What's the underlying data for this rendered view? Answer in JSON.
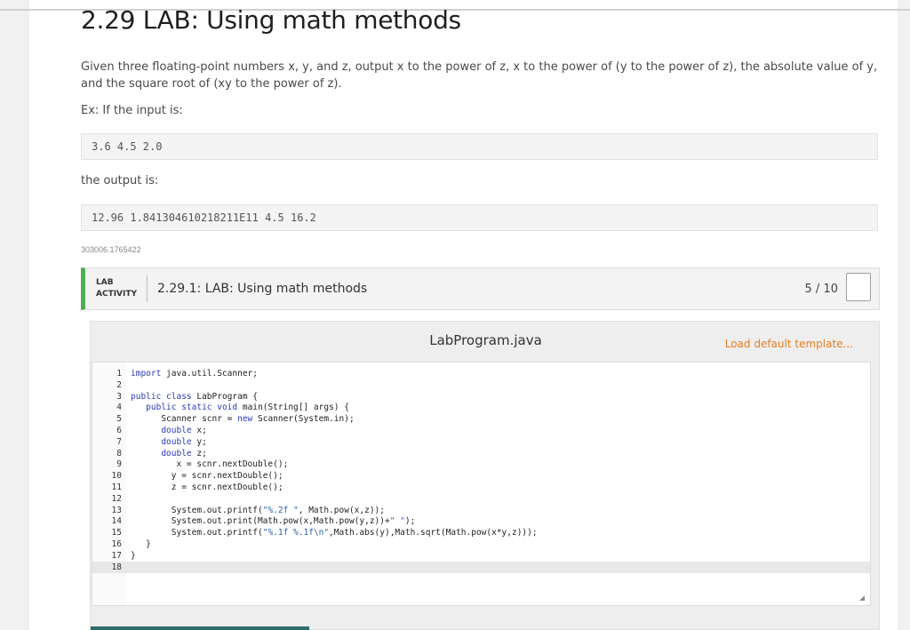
{
  "page": {
    "title": "2.29 LAB: Using math methods",
    "description": "Given three floating-point numbers x, y, and z, output x to the power of z, x to the power of (y to the power of z), the absolute value of y, and the square root of (xy to the power of z).",
    "example_label": "Ex: If the input is:",
    "input_example": "3.6 4.5 2.0",
    "output_label": "the output is:",
    "output_example": "12.96 1.841304610218211E11 4.5 16.2",
    "id_text": "303006.1765422"
  },
  "activity": {
    "tag_line1": "LAB",
    "tag_line2": "ACTIVITY",
    "title": "2.29.1: LAB: Using math methods",
    "score": "5 / 10",
    "accent_color": "#4caf50"
  },
  "editor": {
    "file_name": "LabProgram.java",
    "load_template": "Load default template...",
    "lines": [
      {
        "n": "1",
        "segments": [
          {
            "t": "import",
            "c": "kw"
          },
          {
            "t": " java.util.Scanner;",
            "c": ""
          }
        ]
      },
      {
        "n": "2",
        "segments": []
      },
      {
        "n": "3",
        "segments": [
          {
            "t": "public class",
            "c": "kw"
          },
          {
            "t": " LabProgram {",
            "c": ""
          }
        ]
      },
      {
        "n": "4",
        "segments": [
          {
            "t": "   ",
            "c": ""
          },
          {
            "t": "public static void",
            "c": "kw"
          },
          {
            "t": " main(String[] args) {",
            "c": ""
          }
        ]
      },
      {
        "n": "5",
        "segments": [
          {
            "t": "      Scanner scnr = ",
            "c": ""
          },
          {
            "t": "new",
            "c": "kw"
          },
          {
            "t": " Scanner(System.in);",
            "c": ""
          }
        ]
      },
      {
        "n": "6",
        "segments": [
          {
            "t": "      ",
            "c": ""
          },
          {
            "t": "double",
            "c": "kw"
          },
          {
            "t": " x;",
            "c": ""
          }
        ]
      },
      {
        "n": "7",
        "segments": [
          {
            "t": "      ",
            "c": ""
          },
          {
            "t": "double",
            "c": "kw"
          },
          {
            "t": " y;",
            "c": ""
          }
        ]
      },
      {
        "n": "8",
        "segments": [
          {
            "t": "      ",
            "c": ""
          },
          {
            "t": "double",
            "c": "kw"
          },
          {
            "t": " z;",
            "c": ""
          }
        ]
      },
      {
        "n": "9",
        "segments": [
          {
            "t": "         x = scnr.nextDouble();",
            "c": ""
          }
        ]
      },
      {
        "n": "10",
        "segments": [
          {
            "t": "        y = scnr.nextDouble();",
            "c": ""
          }
        ]
      },
      {
        "n": "11",
        "segments": [
          {
            "t": "        z = scnr.nextDouble();",
            "c": ""
          }
        ]
      },
      {
        "n": "12",
        "segments": []
      },
      {
        "n": "13",
        "segments": [
          {
            "t": "        System.out.printf(",
            "c": ""
          },
          {
            "t": "\"%.2f \"",
            "c": "str"
          },
          {
            "t": ", Math.pow(x,z));",
            "c": ""
          }
        ]
      },
      {
        "n": "14",
        "segments": [
          {
            "t": "        System.out.print(Math.pow(x,Math.pow(y,z))+",
            "c": ""
          },
          {
            "t": "\" \"",
            "c": "str"
          },
          {
            "t": ");",
            "c": ""
          }
        ]
      },
      {
        "n": "15",
        "segments": [
          {
            "t": "        System.out.printf(",
            "c": ""
          },
          {
            "t": "\"%.1f %.1f\\n\"",
            "c": "str"
          },
          {
            "t": ",Math.abs(y),Math.sqrt(Math.pow(x*y,z)));",
            "c": ""
          }
        ]
      },
      {
        "n": "16",
        "segments": [
          {
            "t": "   }",
            "c": ""
          }
        ]
      },
      {
        "n": "17",
        "segments": [
          {
            "t": "}",
            "c": ""
          }
        ]
      },
      {
        "n": "18",
        "segments": [],
        "active": true
      }
    ]
  }
}
